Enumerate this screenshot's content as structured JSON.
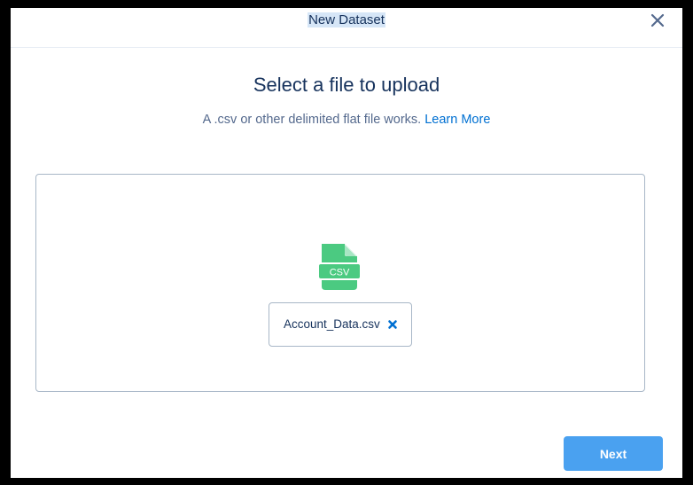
{
  "header": {
    "title": "New Dataset",
    "close_icon": "close-icon"
  },
  "main": {
    "heading": "Select a file to upload",
    "description": "A .csv or other delimited flat file works.",
    "learn_more_link": "Learn More"
  },
  "dropzone": {
    "file_icon": "csv-file-icon",
    "file_icon_label": "CSV",
    "file_name": "Account_Data.csv",
    "remove_icon": "remove-file-icon"
  },
  "footer": {
    "next_label": "Next"
  },
  "colors": {
    "accent": "#0070d2",
    "button": "#4aa1f0",
    "csv_icon": "#4bca81",
    "text_primary": "#16325c",
    "text_secondary": "#54698d"
  }
}
